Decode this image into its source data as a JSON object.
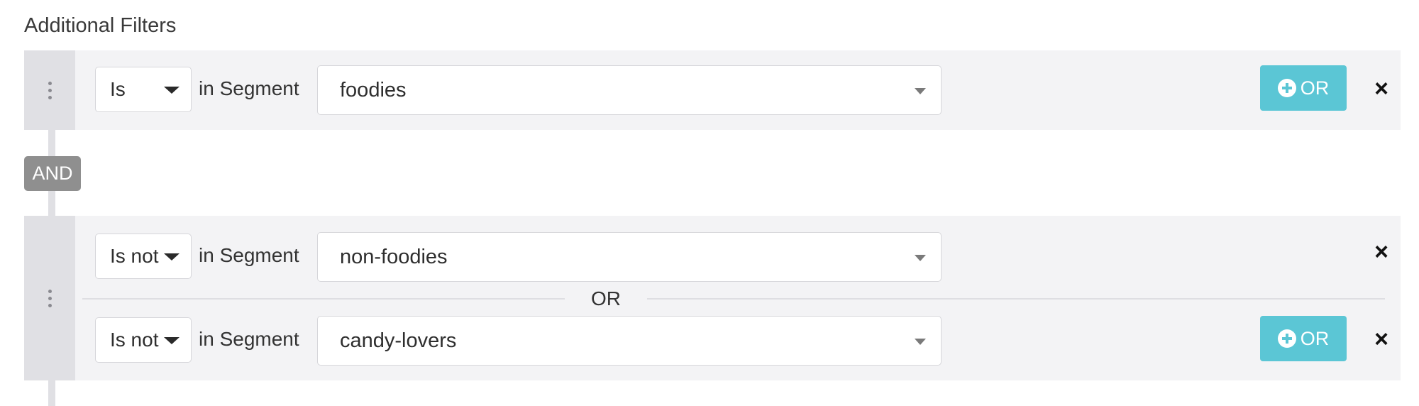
{
  "section": {
    "title": "Additional Filters"
  },
  "groups": [
    {
      "rows": [
        {
          "operator": "Is",
          "in_segment_label": "in Segment",
          "segment": "foodies",
          "or_button_label": "OR",
          "close_label": "×"
        }
      ]
    },
    {
      "rows": [
        {
          "operator": "Is not",
          "in_segment_label": "in Segment",
          "segment": "non-foodies",
          "close_label": "×"
        },
        {
          "operator": "Is not",
          "in_segment_label": "in Segment",
          "segment": "candy-lovers",
          "or_button_label": "OR",
          "close_label": "×"
        }
      ],
      "or_separator": "OR"
    }
  ],
  "and_badge": "AND",
  "colors": {
    "or_button": "#5bc6d5",
    "and_badge": "#8f8f8f",
    "group_background": "#f3f3f5",
    "handle": "#e0e0e4"
  },
  "icons": [
    "drag-handle-icon",
    "plus-circle-icon",
    "close-icon",
    "chevron-down-icon"
  ]
}
